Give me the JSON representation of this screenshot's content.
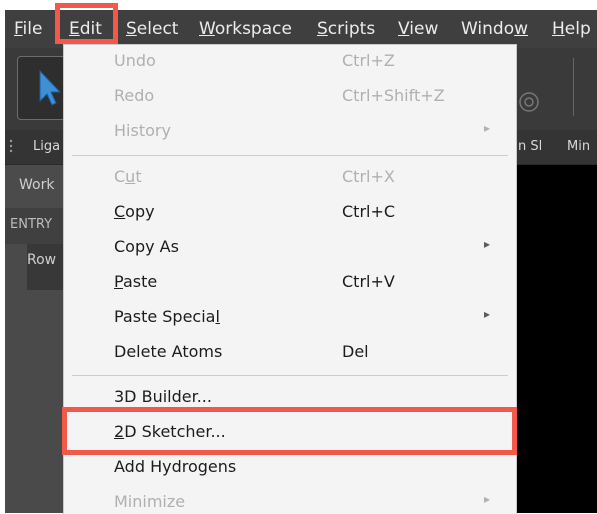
{
  "menubar": {
    "items": [
      {
        "pre": "",
        "mn": "F",
        "post": "ile"
      },
      {
        "pre": "",
        "mn": "E",
        "post": "dit"
      },
      {
        "pre": "",
        "mn": "S",
        "post": "elect"
      },
      {
        "pre": "",
        "mn": "W",
        "post": "orkspace"
      },
      {
        "pre": "",
        "mn": "S",
        "post": "cripts"
      },
      {
        "pre": "",
        "mn": "V",
        "post": "iew"
      },
      {
        "pre": "Windo",
        "mn": "w",
        "post": ""
      },
      {
        "pre": "",
        "mn": "H",
        "post": "elp"
      }
    ]
  },
  "background": {
    "tab_left": "Liga",
    "tab_right_1": "n Sl",
    "tab_right_2": "Min",
    "workspace_label": "Work",
    "entry_label": "ENTRY",
    "row_label": "Row"
  },
  "edit_menu": {
    "undo": {
      "label": "Undo",
      "shortcut": "Ctrl+Z"
    },
    "redo": {
      "label": "Redo",
      "shortcut": "Ctrl+Shift+Z"
    },
    "history": {
      "label": "History",
      "arrow": "▸"
    },
    "cut": {
      "pre": "C",
      "mn": "u",
      "post": "t",
      "shortcut": "Ctrl+X"
    },
    "copy": {
      "pre": "",
      "mn": "C",
      "post": "opy",
      "shortcut": "Ctrl+C"
    },
    "copy_as": {
      "label": "Copy As",
      "arrow": "▸"
    },
    "paste": {
      "pre": "",
      "mn": "P",
      "post": "aste",
      "shortcut": "Ctrl+V"
    },
    "paste_special": {
      "pre": "Paste Specia",
      "mn": "l",
      "post": "",
      "arrow": "▸"
    },
    "delete_atoms": {
      "label": "Delete Atoms",
      "shortcut": "Del"
    },
    "builder_3d": {
      "label": "3D Builder..."
    },
    "sketcher_2d": {
      "pre": "",
      "mn": "2",
      "post": "D Sketcher..."
    },
    "add_hydrogens": {
      "label": "Add Hydrogens"
    },
    "minimize": {
      "label": "Minimize",
      "arrow": "▸"
    }
  },
  "colors": {
    "highlight": "#f2594b",
    "menu_bg": "#f4f4f4",
    "app_bg": "#4a4a4a"
  }
}
